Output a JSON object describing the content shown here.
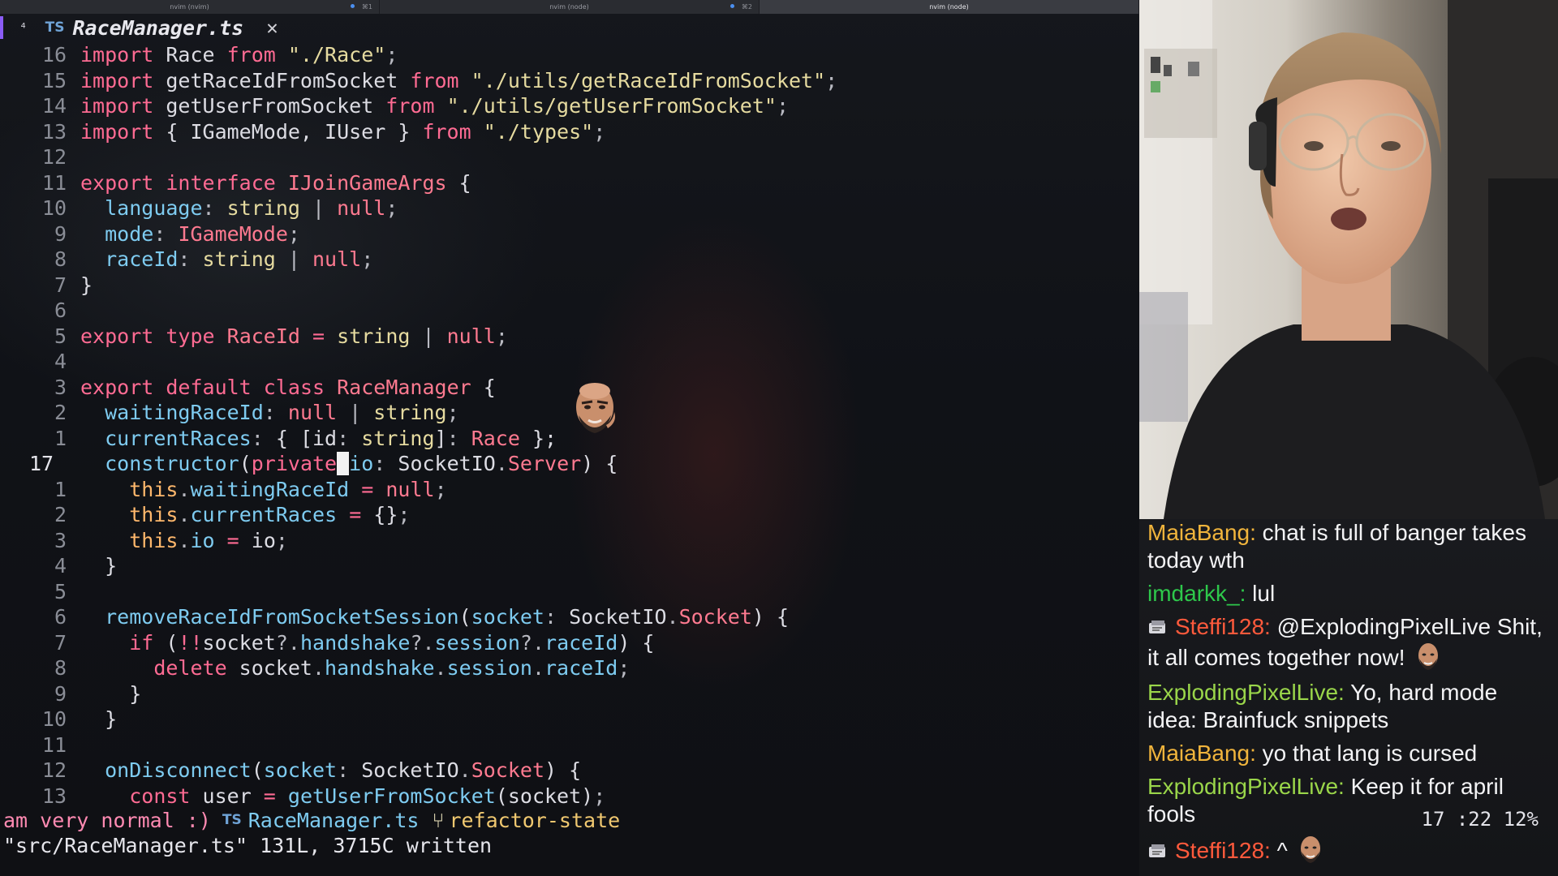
{
  "terminal": {
    "tabs": [
      {
        "label": "nvim (nvim)",
        "shortcut": "⌘1",
        "active": false,
        "dot": true
      },
      {
        "label": "nvim (node)",
        "shortcut": "⌘2",
        "active": false,
        "dot": true
      },
      {
        "label": "nvim (node)",
        "shortcut": "",
        "active": true,
        "dot": false
      }
    ]
  },
  "editor": {
    "buffer_tab": {
      "modified_marker": "⁴",
      "filetype_icon": "TS",
      "filename": "RaceManager.ts",
      "close_glyph": "✕"
    },
    "lines": [
      {
        "n": "16",
        "tokens": [
          [
            "kw",
            "import"
          ],
          [
            "plain",
            " Race "
          ],
          [
            "kw",
            "from"
          ],
          [
            "plain",
            " "
          ],
          [
            "str",
            "\"./Race\""
          ],
          [
            "punc",
            ";"
          ]
        ]
      },
      {
        "n": "15",
        "tokens": [
          [
            "kw",
            "import"
          ],
          [
            "plain",
            " getRaceIdFromSocket "
          ],
          [
            "kw",
            "from"
          ],
          [
            "plain",
            " "
          ],
          [
            "str",
            "\"./utils/getRaceIdFromSocket\""
          ],
          [
            "punc",
            ";"
          ]
        ]
      },
      {
        "n": "14",
        "tokens": [
          [
            "kw",
            "import"
          ],
          [
            "plain",
            " getUserFromSocket "
          ],
          [
            "kw",
            "from"
          ],
          [
            "plain",
            " "
          ],
          [
            "str",
            "\"./utils/getUserFromSocket\""
          ],
          [
            "punc",
            ";"
          ]
        ]
      },
      {
        "n": "13",
        "tokens": [
          [
            "kw",
            "import"
          ],
          [
            "plain",
            " { IGameMode, IUser } "
          ],
          [
            "kw",
            "from"
          ],
          [
            "plain",
            " "
          ],
          [
            "str",
            "\"./types\""
          ],
          [
            "punc",
            ";"
          ]
        ]
      },
      {
        "n": "12",
        "tokens": []
      },
      {
        "n": "11",
        "tokens": [
          [
            "kw",
            "export"
          ],
          [
            "plain",
            " "
          ],
          [
            "kw",
            "interface"
          ],
          [
            "plain",
            " "
          ],
          [
            "type",
            "IJoinGameArgs"
          ],
          [
            "plain",
            " {"
          ]
        ]
      },
      {
        "n": "10",
        "tokens": [
          [
            "plain",
            "  "
          ],
          [
            "prop",
            "language"
          ],
          [
            "punc",
            ": "
          ],
          [
            "str",
            "string"
          ],
          [
            "punc",
            " | "
          ],
          [
            "type",
            "null"
          ],
          [
            "punc",
            ";"
          ]
        ]
      },
      {
        "n": "9",
        "tokens": [
          [
            "plain",
            "  "
          ],
          [
            "prop",
            "mode"
          ],
          [
            "punc",
            ": "
          ],
          [
            "type",
            "IGameMode"
          ],
          [
            "punc",
            ";"
          ]
        ]
      },
      {
        "n": "8",
        "tokens": [
          [
            "plain",
            "  "
          ],
          [
            "prop",
            "raceId"
          ],
          [
            "punc",
            ": "
          ],
          [
            "str",
            "string"
          ],
          [
            "punc",
            " | "
          ],
          [
            "type",
            "null"
          ],
          [
            "punc",
            ";"
          ]
        ]
      },
      {
        "n": "7",
        "tokens": [
          [
            "plain",
            "}"
          ]
        ]
      },
      {
        "n": "6",
        "tokens": []
      },
      {
        "n": "5",
        "tokens": [
          [
            "kw",
            "export"
          ],
          [
            "plain",
            " "
          ],
          [
            "kw",
            "type"
          ],
          [
            "plain",
            " "
          ],
          [
            "type",
            "RaceId"
          ],
          [
            "plain",
            " "
          ],
          [
            "op",
            "="
          ],
          [
            "plain",
            " "
          ],
          [
            "str",
            "string"
          ],
          [
            "punc",
            " | "
          ],
          [
            "type",
            "null"
          ],
          [
            "punc",
            ";"
          ]
        ]
      },
      {
        "n": "4",
        "tokens": []
      },
      {
        "n": "3",
        "tokens": [
          [
            "kw",
            "export"
          ],
          [
            "plain",
            " "
          ],
          [
            "kw",
            "default"
          ],
          [
            "plain",
            " "
          ],
          [
            "kw",
            "class"
          ],
          [
            "plain",
            " "
          ],
          [
            "type",
            "RaceManager"
          ],
          [
            "plain",
            " {"
          ]
        ]
      },
      {
        "n": "2",
        "tokens": [
          [
            "plain",
            "  "
          ],
          [
            "prop",
            "waitingRaceId"
          ],
          [
            "punc",
            ": "
          ],
          [
            "type",
            "null"
          ],
          [
            "punc",
            " | "
          ],
          [
            "str",
            "string"
          ],
          [
            "punc",
            ";"
          ]
        ]
      },
      {
        "n": "1",
        "tokens": [
          [
            "plain",
            "  "
          ],
          [
            "prop",
            "currentRaces"
          ],
          [
            "punc",
            ": "
          ],
          [
            "plain",
            "{ [id"
          ],
          [
            "punc",
            ": "
          ],
          [
            "str",
            "string"
          ],
          [
            "plain",
            "]"
          ],
          [
            "punc",
            ": "
          ],
          [
            "type",
            "Race"
          ],
          [
            "plain",
            " };"
          ]
        ]
      },
      {
        "n": "17",
        "current": true,
        "tokens": [
          [
            "plain",
            "  "
          ],
          [
            "fn",
            "constructor"
          ],
          [
            "plain",
            "("
          ],
          [
            "kw",
            "private"
          ],
          [
            "cursor",
            " "
          ],
          [
            "prop",
            "io"
          ],
          [
            "punc",
            ": "
          ],
          [
            "plain",
            "SocketIO"
          ],
          [
            "punc",
            "."
          ],
          [
            "type",
            "Server"
          ],
          [
            "plain",
            ") {"
          ]
        ]
      },
      {
        "n": "1",
        "tokens": [
          [
            "plain",
            "    "
          ],
          [
            "this",
            "this"
          ],
          [
            "punc",
            "."
          ],
          [
            "prop",
            "waitingRaceId"
          ],
          [
            "plain",
            " "
          ],
          [
            "op",
            "="
          ],
          [
            "plain",
            " "
          ],
          [
            "type",
            "null"
          ],
          [
            "punc",
            ";"
          ]
        ]
      },
      {
        "n": "2",
        "tokens": [
          [
            "plain",
            "    "
          ],
          [
            "this",
            "this"
          ],
          [
            "punc",
            "."
          ],
          [
            "prop",
            "currentRaces"
          ],
          [
            "plain",
            " "
          ],
          [
            "op",
            "="
          ],
          [
            "plain",
            " {}"
          ],
          [
            "punc",
            ";"
          ]
        ]
      },
      {
        "n": "3",
        "tokens": [
          [
            "plain",
            "    "
          ],
          [
            "this",
            "this"
          ],
          [
            "punc",
            "."
          ],
          [
            "prop",
            "io"
          ],
          [
            "plain",
            " "
          ],
          [
            "op",
            "="
          ],
          [
            "plain",
            " io"
          ],
          [
            "punc",
            ";"
          ]
        ]
      },
      {
        "n": "4",
        "tokens": [
          [
            "plain",
            "  }"
          ]
        ]
      },
      {
        "n": "5",
        "tokens": []
      },
      {
        "n": "6",
        "tokens": [
          [
            "plain",
            "  "
          ],
          [
            "fn",
            "removeRaceIdFromSocketSession"
          ],
          [
            "plain",
            "("
          ],
          [
            "prop",
            "socket"
          ],
          [
            "punc",
            ": "
          ],
          [
            "plain",
            "SocketIO"
          ],
          [
            "punc",
            "."
          ],
          [
            "type",
            "Socket"
          ],
          [
            "plain",
            ") {"
          ]
        ]
      },
      {
        "n": "7",
        "tokens": [
          [
            "plain",
            "    "
          ],
          [
            "kw",
            "if"
          ],
          [
            "plain",
            " ("
          ],
          [
            "op",
            "!!"
          ],
          [
            "plain",
            "socket"
          ],
          [
            "punc",
            "?."
          ],
          [
            "prop",
            "handshake"
          ],
          [
            "punc",
            "?."
          ],
          [
            "prop",
            "session"
          ],
          [
            "punc",
            "?."
          ],
          [
            "prop",
            "raceId"
          ],
          [
            "plain",
            ") {"
          ]
        ]
      },
      {
        "n": "8",
        "tokens": [
          [
            "plain",
            "      "
          ],
          [
            "kw",
            "delete"
          ],
          [
            "plain",
            " socket"
          ],
          [
            "punc",
            "."
          ],
          [
            "prop",
            "handshake"
          ],
          [
            "punc",
            "."
          ],
          [
            "prop",
            "session"
          ],
          [
            "punc",
            "."
          ],
          [
            "prop",
            "raceId"
          ],
          [
            "punc",
            ";"
          ]
        ]
      },
      {
        "n": "9",
        "tokens": [
          [
            "plain",
            "    }"
          ]
        ]
      },
      {
        "n": "10",
        "tokens": [
          [
            "plain",
            "  }"
          ]
        ]
      },
      {
        "n": "11",
        "tokens": []
      },
      {
        "n": "12",
        "tokens": [
          [
            "plain",
            "  "
          ],
          [
            "fn",
            "onDisconnect"
          ],
          [
            "plain",
            "("
          ],
          [
            "prop",
            "socket"
          ],
          [
            "punc",
            ": "
          ],
          [
            "plain",
            "SocketIO"
          ],
          [
            "punc",
            "."
          ],
          [
            "type",
            "Socket"
          ],
          [
            "plain",
            ") {"
          ]
        ]
      },
      {
        "n": "13",
        "tokens": [
          [
            "plain",
            "    "
          ],
          [
            "kw",
            "const"
          ],
          [
            "plain",
            " user "
          ],
          [
            "op",
            "="
          ],
          [
            "plain",
            " "
          ],
          [
            "fn",
            "getUserFromSocket"
          ],
          [
            "plain",
            "(socket)"
          ],
          [
            "punc",
            ";"
          ]
        ]
      }
    ],
    "statusline": {
      "mode_text": "am very normal :)",
      "filetype_icon": "TS",
      "filename": "RaceManager.ts",
      "branch_icon": "⑂",
      "branch": "refactor-state"
    },
    "cmdline": "\"src/RaceManager.ts\" 131L, 3715C written",
    "position": "17 :22 12%"
  },
  "chat": {
    "messages": [
      {
        "user": "MaiaBang",
        "color": "#f0b43c",
        "text": "chat is full of banger takes today wth",
        "badge": false,
        "emote": false
      },
      {
        "user": "imdarkk_",
        "color": "#2ec84b",
        "text": "lul",
        "badge": false,
        "emote": false
      },
      {
        "user": "Steffi128",
        "color": "#ff5a3c",
        "text": "@ExplodingPixelLive Shit, it all comes together now!",
        "badge": true,
        "emote": true
      },
      {
        "user": "ExplodingPixelLive",
        "color": "#9ad64a",
        "text": "Yo, hard mode idea: Brainfuck snippets",
        "badge": false,
        "emote": false
      },
      {
        "user": "MaiaBang",
        "color": "#f0b43c",
        "text": "yo that lang is cursed",
        "badge": false,
        "emote": false
      },
      {
        "user": "ExplodingPixelLive",
        "color": "#9ad64a",
        "text": "Keep it for april fools",
        "badge": false,
        "emote": false
      },
      {
        "user": "Steffi128",
        "color": "#ff5a3c",
        "text": "^",
        "badge": true,
        "emote": true
      }
    ]
  },
  "colors": {
    "keyword": "#ff6b93",
    "string": "#e6dba0",
    "property": "#7ecbf0",
    "background": "#101217"
  }
}
